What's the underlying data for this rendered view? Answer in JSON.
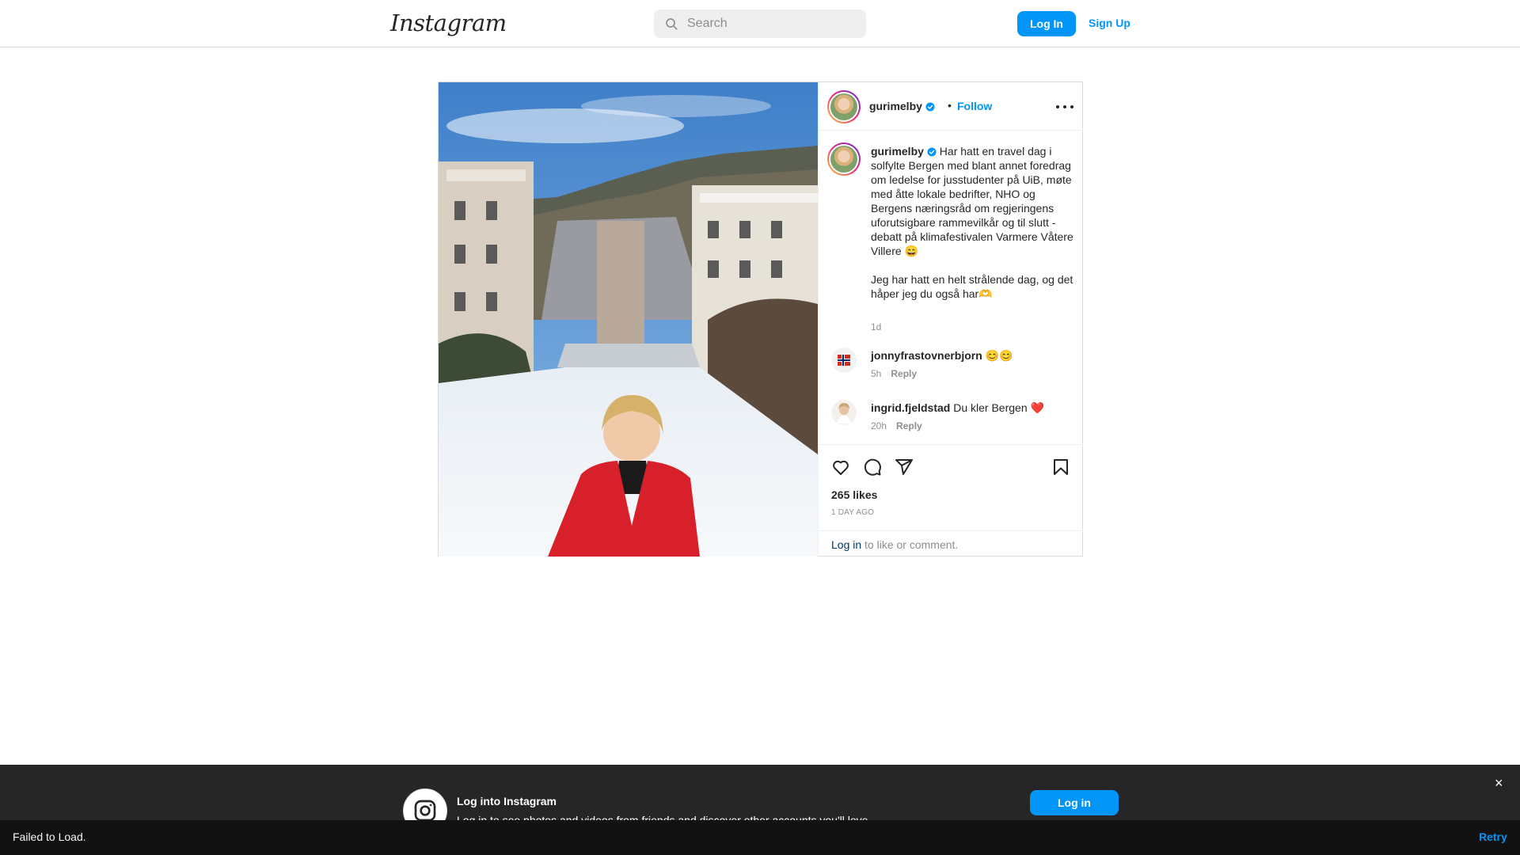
{
  "header": {
    "logo": "Instagram",
    "search_placeholder": "Search",
    "login_label": "Log In",
    "signup_label": "Sign Up"
  },
  "post": {
    "username": "gurimelby",
    "follow_label": "Follow",
    "separator": "•",
    "caption_p1": "Har hatt en travel dag i solfylte Bergen med blant annet foredrag om ledelse for jusstudenter på UiB, møte med åtte lokale bedrifter, NHO og Bergens næringsråd om regjeringens uforutsigbare rammevilkår og til slutt - debatt på klimafestivalen Varmere Våtere Villere 😄",
    "caption_p2": "Jeg har hatt en helt strålende dag, og det håper jeg du også har🫶",
    "caption_time": "1d",
    "comments": [
      {
        "username": "jonnyfrastovnerbjorn",
        "text": "😊😊",
        "time": "5h",
        "reply": "Reply"
      },
      {
        "username": "ingrid.fjeldstad",
        "text": "Du kler Bergen ❤️",
        "time": "20h",
        "reply": "Reply"
      }
    ],
    "likes": "265 likes",
    "date": "1 DAY AGO",
    "login_link": "Log in",
    "login_suffix": " to like or comment."
  },
  "icons": [
    "search-icon",
    "verified-icon",
    "more-icon",
    "heart-icon",
    "comment-icon",
    "share-icon",
    "bookmark-icon",
    "instagram-icon",
    "close-icon"
  ],
  "colors": {
    "accent": "#0095f6",
    "text": "#262626",
    "muted": "#8e8e8e",
    "banner_bg": "#262626",
    "coat_red": "#d8202a"
  },
  "banner": {
    "title": "Log into Instagram",
    "subtitle": "Log in to see photos and videos from friends and discover other accounts you'll love.",
    "button_label": "Log in",
    "close": "×"
  },
  "error_bar": {
    "message": "Failed to Load.",
    "retry_label": "Retry"
  }
}
